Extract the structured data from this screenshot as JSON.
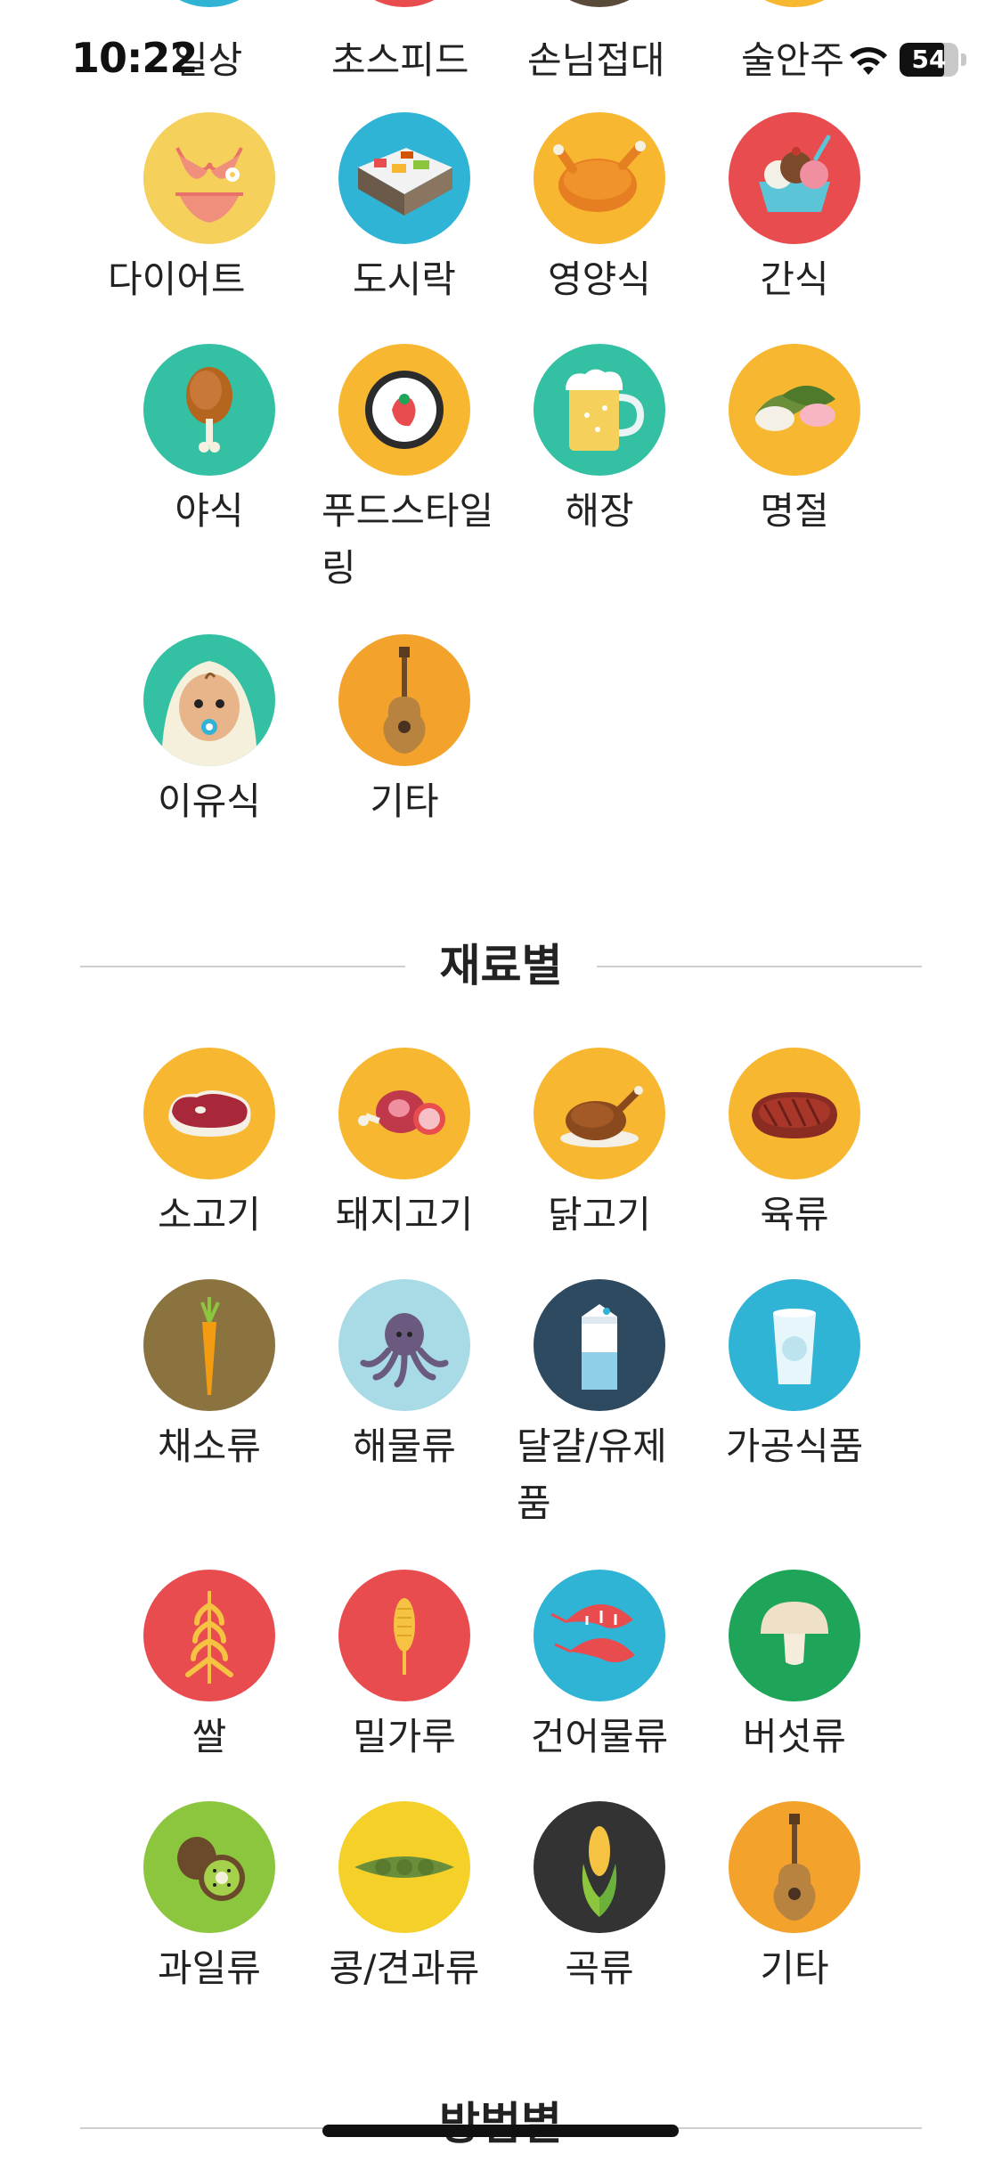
{
  "status_bar": {
    "time": "10:22",
    "battery": "54"
  },
  "top_partial_labels": [
    "일상",
    "초스피드",
    "손님접대",
    "술안주"
  ],
  "colors": {
    "yellow": "#f5d05a",
    "blue": "#2fb4d6",
    "orange": "#f7b731",
    "red": "#e84c4f",
    "teal": "#34c0a2",
    "green": "#1ea55a",
    "olive": "#8b7340",
    "lightblue": "#a8dbe5",
    "navy": "#2d4a60",
    "lime": "#8cc63f",
    "dark": "#333333",
    "guitar_orange": "#f3a32c"
  },
  "situation_items": [
    {
      "label": "다이어트",
      "icon": "bikini-icon"
    },
    {
      "label": "도시락",
      "icon": "lunchbox-icon"
    },
    {
      "label": "영양식",
      "icon": "roast-chicken-icon"
    },
    {
      "label": "간식",
      "icon": "ice-cream-icon"
    },
    {
      "label": "야식",
      "icon": "drumstick-icon"
    },
    {
      "label": "푸드스타일링",
      "icon": "plate-icon"
    },
    {
      "label": "해장",
      "icon": "beer-icon"
    },
    {
      "label": "명절",
      "icon": "songpyeon-icon"
    },
    {
      "label": "이유식",
      "icon": "baby-icon"
    },
    {
      "label": "기타",
      "icon": "guitar-icon"
    }
  ],
  "ingredient_section": {
    "title": "재료별",
    "items": [
      {
        "label": "소고기",
        "icon": "beef-icon"
      },
      {
        "label": "돼지고기",
        "icon": "pork-icon"
      },
      {
        "label": "닭고기",
        "icon": "chicken-icon"
      },
      {
        "label": "육류",
        "icon": "steak-icon"
      },
      {
        "label": "채소류",
        "icon": "carrot-icon"
      },
      {
        "label": "해물류",
        "icon": "octopus-icon"
      },
      {
        "label": "달걀/유제품",
        "icon": "milk-icon"
      },
      {
        "label": "가공식품",
        "icon": "yogurt-icon"
      },
      {
        "label": "쌀",
        "icon": "rice-icon"
      },
      {
        "label": "밀가루",
        "icon": "wheat-icon"
      },
      {
        "label": "건어물류",
        "icon": "shrimp-icon"
      },
      {
        "label": "버섯류",
        "icon": "mushroom-icon"
      },
      {
        "label": "과일류",
        "icon": "kiwi-icon"
      },
      {
        "label": "콩/견과류",
        "icon": "pea-pod-icon"
      },
      {
        "label": "곡류",
        "icon": "corn-icon"
      },
      {
        "label": "기타",
        "icon": "guitar-icon"
      }
    ]
  },
  "method_section": {
    "title": "방법별"
  }
}
